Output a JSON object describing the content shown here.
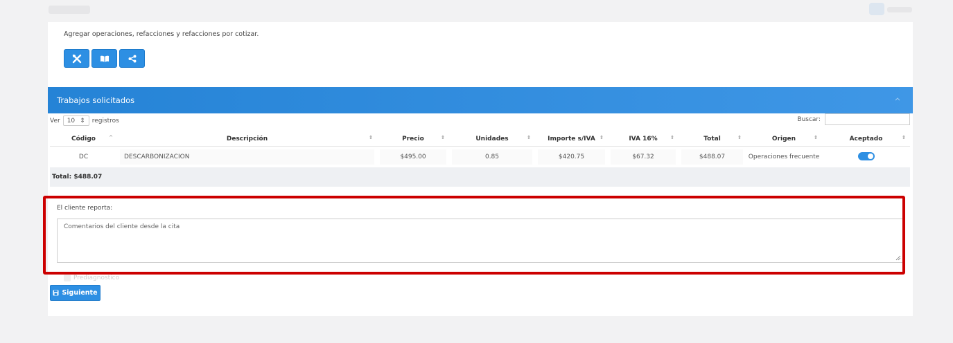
{
  "intro_text": "Agregar operaciones, refacciones y refacciones por cotizar.",
  "toolbar": {
    "buttons": [
      {
        "icon": "tools-icon"
      },
      {
        "icon": "book-icon"
      },
      {
        "icon": "share-icon"
      }
    ]
  },
  "panel": {
    "title": "Trabajos solicitados"
  },
  "table_controls": {
    "show_label": "Ver",
    "page_size": "10",
    "records_label": "registros",
    "search_label": "Buscar:"
  },
  "table": {
    "columns": [
      "Código",
      "Descripción",
      "Precio",
      "Unidades",
      "Importe s/IVA",
      "IVA 16%",
      "Total",
      "Origen",
      "Aceptado"
    ],
    "rows": [
      {
        "codigo": "DC",
        "descripcion": "DESCARBONIZACION",
        "precio": "$495.00",
        "unidades": "0.85",
        "importe": "$420.75",
        "iva": "$67.32",
        "total": "$488.07",
        "origen": "Operaciones frecuente",
        "aceptado": true
      }
    ],
    "total_label": "Total: $488.07"
  },
  "client_report": {
    "label": "El cliente reporta:",
    "value": "Comentarios del cliente desde la cita"
  },
  "prediagnostico_label": "Prediagnostico",
  "next_button_label": "Siguiente",
  "colors": {
    "accent": "#2d8fe3",
    "highlight": "#cc0000"
  }
}
